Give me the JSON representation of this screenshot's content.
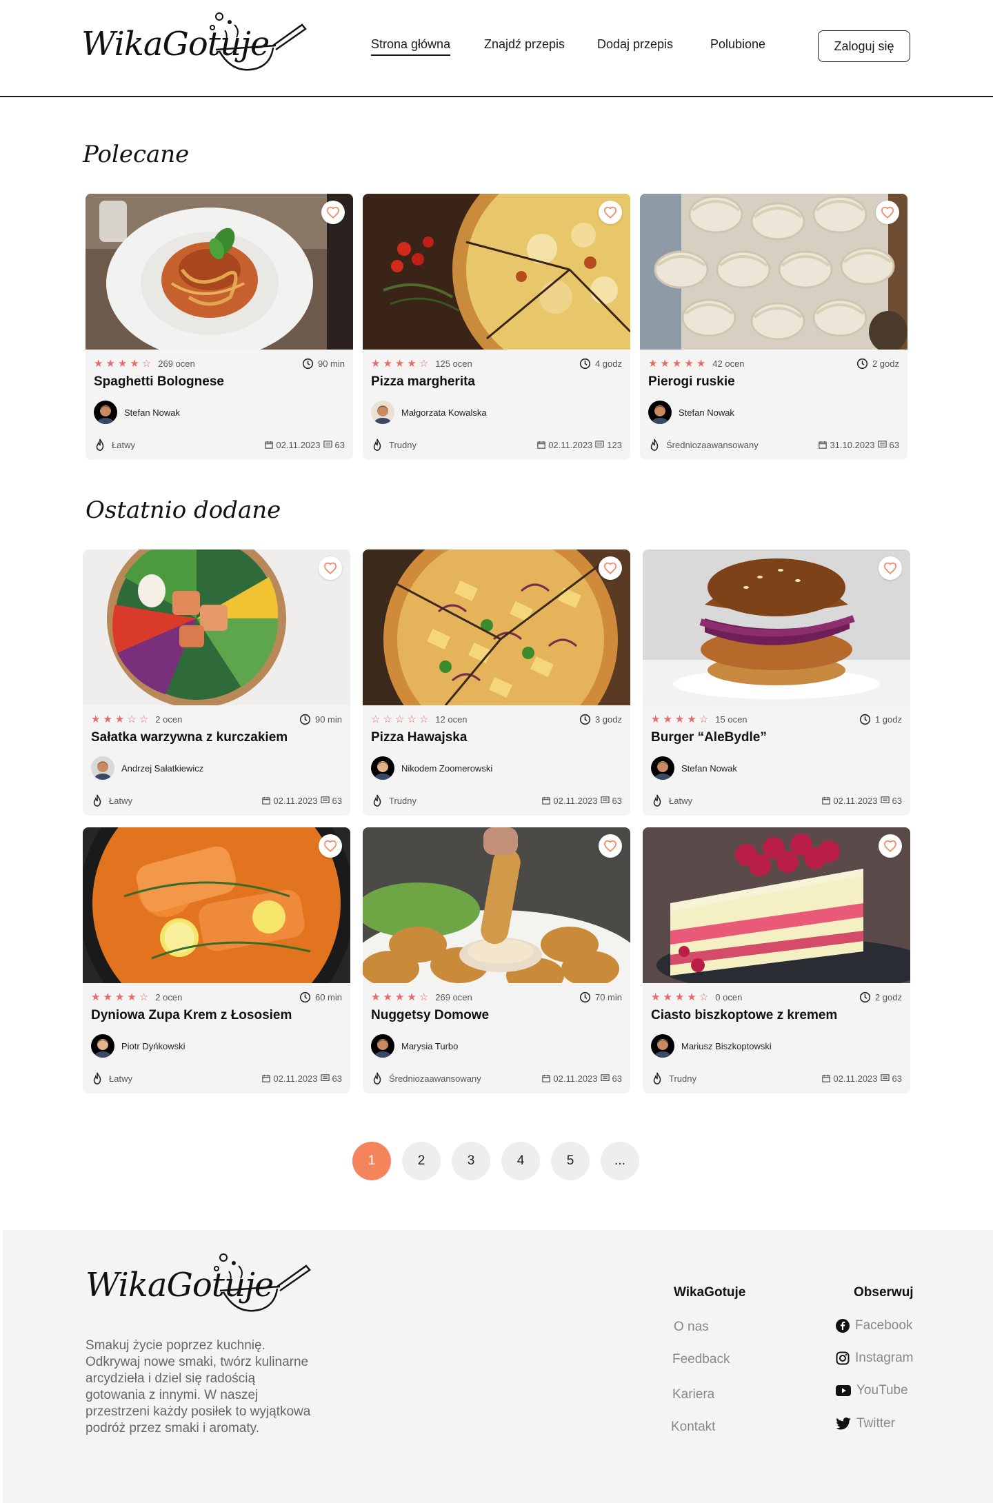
{
  "header": {
    "logo_text": "WikaGotuje",
    "nav": [
      {
        "label": "Strona główna",
        "active": true
      },
      {
        "label": "Znajdź przepis",
        "active": false
      },
      {
        "label": "Dodaj przepis",
        "active": false
      },
      {
        "label": "Polubione",
        "active": false
      }
    ],
    "login_label": "Zaloguj się"
  },
  "recommended": {
    "title": "Polecane",
    "cards": [
      {
        "title": "Spaghetti Bolognese",
        "stars": 4,
        "ratings": "269 ocen",
        "time": "90 min",
        "author": "Stefan Nowak",
        "difficulty": "Łatwy",
        "date": "02.11.2023",
        "comments": "63",
        "image": "spaghetti"
      },
      {
        "title": "Pizza margherita",
        "stars": 4,
        "ratings": "125 ocen",
        "time": "4 godz",
        "author": "Małgorzata Kowalska",
        "difficulty": "Trudny",
        "date": "02.11.2023",
        "comments": "123",
        "image": "pizza-margherita"
      },
      {
        "title": "Pierogi ruskie",
        "stars": 5,
        "ratings": "42 ocen",
        "time": "2 godz",
        "author": "Stefan Nowak",
        "difficulty": "Średniozaawansowany",
        "date": "31.10.2023",
        "comments": "63",
        "image": "pierogi"
      }
    ]
  },
  "recent": {
    "title": "Ostatnio dodane",
    "cards": [
      {
        "title": "Sałatka warzywna z kurczakiem",
        "stars": 3,
        "ratings": "2 ocen",
        "time": "90 min",
        "author": "Andrzej Sałatkiewicz",
        "difficulty": "Łatwy",
        "date": "02.11.2023",
        "comments": "63",
        "image": "salad"
      },
      {
        "title": "Pizza Hawajska",
        "stars": 0,
        "ratings": "12 ocen",
        "time": "3 godz",
        "author": "Nikodem Zoomerowski",
        "difficulty": "Trudny",
        "date": "02.11.2023",
        "comments": "63",
        "image": "pizza-hawaii"
      },
      {
        "title": "Burger “AleBydle”",
        "stars": 4,
        "ratings": "15 ocen",
        "time": "1 godz",
        "author": "Stefan Nowak",
        "difficulty": "Łatwy",
        "date": "02.11.2023",
        "comments": "63",
        "image": "burger"
      },
      {
        "title": "Dyniowa Zupa Krem z Łososiem",
        "stars": 4,
        "ratings": "2 ocen",
        "time": "60 min",
        "author": "Piotr Dyńkowski",
        "difficulty": "Łatwy",
        "date": "02.11.2023",
        "comments": "63",
        "image": "soup"
      },
      {
        "title": "Nuggetsy Domowe",
        "stars": 4,
        "ratings": "269 ocen",
        "time": "70 min",
        "author": "Marysia Turbo",
        "difficulty": "Średniozaawansowany",
        "date": "02.11.2023",
        "comments": "63",
        "image": "nuggets"
      },
      {
        "title": "Ciasto biszkoptowe z kremem",
        "stars": 4,
        "ratings": "0 ocen",
        "time": "2 godz",
        "author": "Mariusz Biszkoptowski",
        "difficulty": "Trudny",
        "date": "02.11.2023",
        "comments": "63",
        "image": "cake"
      }
    ]
  },
  "pagination": {
    "pages": [
      "1",
      "2",
      "3",
      "4",
      "5",
      "..."
    ],
    "current": "1"
  },
  "footer": {
    "logo_text": "WikaGotuje",
    "description": "Smakuj życie poprzez kuchnię. Odkrywaj nowe smaki, twórz kulinarne arcydzieła i dziel się radością gotowania z innymi. W naszej przestrzeni każdy posiłek to wyjątkowa podróż przez smaki i aromaty.",
    "col1_title": "WikaGotuje",
    "col1_links": [
      "O nas",
      "Feedback",
      "Kariera",
      "Kontakt"
    ],
    "col2_title": "Obserwuj",
    "social": [
      {
        "label": "Facebook",
        "icon": "facebook-icon"
      },
      {
        "label": "Instagram",
        "icon": "instagram-icon"
      },
      {
        "label": "YouTube",
        "icon": "youtube-icon"
      },
      {
        "label": "Twitter",
        "icon": "twitter-icon"
      }
    ]
  },
  "colors": {
    "accent": "#f4845c",
    "star": "#e86a6a",
    "card_bg": "#f4f4f4",
    "footer_bg": "#f4f4f4"
  }
}
